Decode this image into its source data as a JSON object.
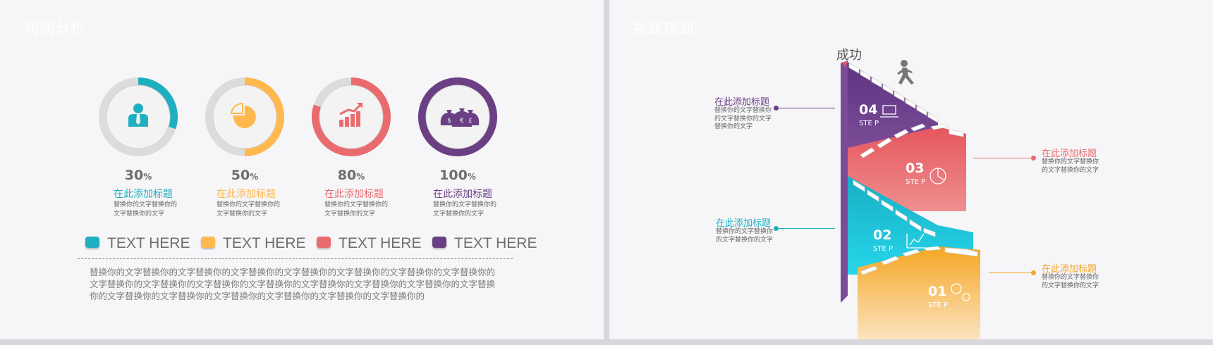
{
  "left_slide": {
    "title": "利润分析",
    "metrics": [
      {
        "percent_number": "30",
        "percent_sign": "%",
        "value": 0.3,
        "color": "#1fb0c0",
        "title": "在此添加标题",
        "body": "替换你的文字替换你的文字替换你的文字",
        "icon": "person-icon"
      },
      {
        "percent_number": "50",
        "percent_sign": "%",
        "value": 0.5,
        "color": "#ffb84d",
        "title": "在此添加标题",
        "body": "替换你的文字替换你的文字替换你的文字",
        "icon": "pie-chart-icon"
      },
      {
        "percent_number": "80",
        "percent_sign": "%",
        "value": 0.8,
        "color": "#ea6b6d",
        "title": "在此添加标题",
        "body": "替换你的文字替换你的文字替换你的文字",
        "icon": "growth-chart-icon"
      },
      {
        "percent_number": "100",
        "percent_sign": "%",
        "value": 1.0,
        "color": "#6a3f84",
        "title": "在此添加标题",
        "body": "替换你的文字替换你的文字替换你的文字",
        "icon": "money-bags-icon"
      }
    ],
    "legend": [
      {
        "label": "TEXT HERE",
        "color": "#1fb0c0"
      },
      {
        "label": "TEXT HERE",
        "color": "#ffb84d"
      },
      {
        "label": "TEXT HERE",
        "color": "#ea6b6d"
      },
      {
        "label": "TEXT HERE",
        "color": "#6a3f84"
      }
    ],
    "paragraph": "替换你的文字替换你的文字替换你的文字替换你的文字替换你的文字替换你的文字替换你的文字替换你的文字替换你的文字替换你的文字替换你的文字替换你的文字替换你的文字替换你的文字替换你的文字替换你的文字替换你的文字替换你的文字替换你的文字替换你的文字替换你的文字替换你的"
  },
  "right_slide": {
    "title": "发展规划",
    "top_label": "成功",
    "steps": [
      {
        "number": "04",
        "label": "STE P",
        "color": "#6a3f84",
        "title": "在此添加标题",
        "body": "替换你的文字替换你的文字替换你的文字替换你的文字"
      },
      {
        "number": "03",
        "label": "STE P",
        "color": "#ea6b6d",
        "title": "在此添加标题",
        "body": "替换你的文字替换你的文字替换你的文字"
      },
      {
        "number": "02",
        "label": "STE P",
        "color": "#1fb0c0",
        "title": "在此添加标题",
        "body": "替换你的文字替换你的文字替换你的文字"
      },
      {
        "number": "01",
        "label": "STE P",
        "color": "#f5a623",
        "title": "在此添加标题",
        "body": "替换你的文字替换你的文字替换你的文字"
      }
    ]
  }
}
